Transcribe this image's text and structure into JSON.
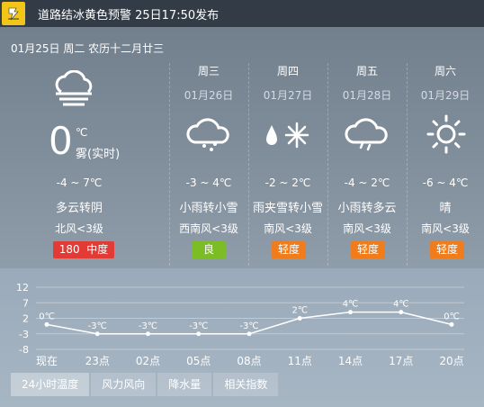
{
  "alert": {
    "icon": "warning-icon",
    "text": "道路结冰黄色预警 25日17:50发布"
  },
  "date_line": "01月25日 周二 农历十二月廿三",
  "today": {
    "icon": "cloudy-fog-icon",
    "temp": "0",
    "unit": "℃",
    "desc": "雾(实时)",
    "range": "-4 ~ 7℃",
    "weather": "多云转阴",
    "wind": "北风<3级",
    "aqi_value": "180",
    "aqi_label": "中度",
    "aqi_color": "#e23b35"
  },
  "forecast": [
    {
      "day": "周三",
      "date": "01月26日",
      "icon": "light-snow-icon",
      "range": "-3 ~ 4℃",
      "weather": "小雨转小雪",
      "wind": "西南风<3级",
      "aqi": "良",
      "aqi_color": "#7cbd26"
    },
    {
      "day": "周四",
      "date": "01月27日",
      "icon": "sleet-icon",
      "range": "-2 ~ 2℃",
      "weather": "雨夹雪转小雪",
      "wind": "南风<3级",
      "aqi": "轻度",
      "aqi_color": "#f07c1b"
    },
    {
      "day": "周五",
      "date": "01月28日",
      "icon": "light-rain-icon",
      "range": "-4 ~ 2℃",
      "weather": "小雨转多云",
      "wind": "南风<3级",
      "aqi": "轻度",
      "aqi_color": "#f07c1b"
    },
    {
      "day": "周六",
      "date": "01月29日",
      "icon": "sunny-icon",
      "range": "-6 ~ 4℃",
      "weather": "晴",
      "wind": "南风<3级",
      "aqi": "轻度",
      "aqi_color": "#f07c1b"
    }
  ],
  "tabs": [
    "24小时温度",
    "风力风向",
    "降水量",
    "相关指数"
  ],
  "chart_data": {
    "type": "line",
    "categories": [
      "现在",
      "23点",
      "02点",
      "05点",
      "08点",
      "11点",
      "14点",
      "17点",
      "20点"
    ],
    "series": [
      {
        "values": [
          0,
          -3,
          -3,
          -3,
          -3,
          2,
          4,
          4,
          0
        ]
      }
    ],
    "data_labels": [
      "0℃",
      "-3℃",
      "-3℃",
      "-3℃",
      "-3℃",
      "2℃",
      "4℃",
      "4℃",
      "0℃"
    ],
    "y_ticks": [
      "12",
      "7",
      "2",
      "-3",
      "-8"
    ],
    "ylim": [
      -8,
      12
    ],
    "grid": true
  }
}
